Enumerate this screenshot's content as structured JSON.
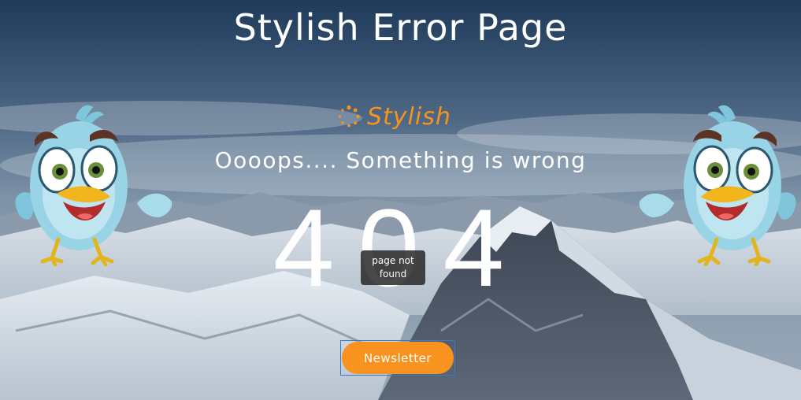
{
  "page": {
    "title": "Stylish Error Page"
  },
  "logo": {
    "text": "Stylish",
    "icon": "spinner-icon",
    "color": "#f7941d"
  },
  "message": {
    "subtitle": "Oooops.... Something is wrong",
    "code": "404",
    "tooltip": "page not found"
  },
  "actions": {
    "newsletter_label": "Newsletter",
    "button_color": "#f7931e"
  },
  "decorations": {
    "left_character": "cartoon-bird",
    "right_character": "cartoon-bird",
    "background": "snowy-mountain-landscape"
  }
}
